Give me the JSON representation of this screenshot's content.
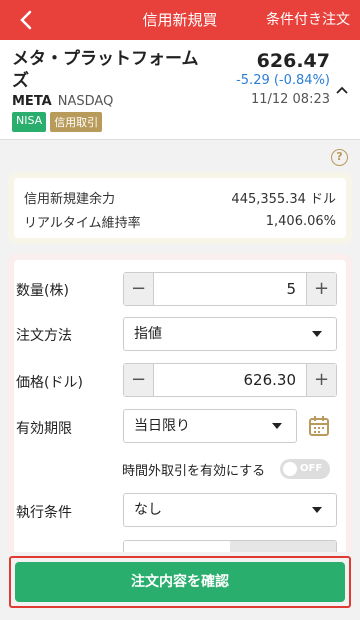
{
  "header": {
    "title": "信用新規買",
    "condition_link": "条件付き注文",
    "back_icon": "chevron-left-icon"
  },
  "stock": {
    "name": "メタ・プラットフォームズ",
    "symbol": "META",
    "exchange": "NASDAQ",
    "badges": [
      "NISA",
      "信用取引"
    ],
    "price": "626.47",
    "change": "-5.29 (-0.84%)",
    "timestamp": "11/12 08:23"
  },
  "info": {
    "rows": [
      {
        "label": "信用新規建余力",
        "value": "445,355.34 ドル"
      },
      {
        "label": "リアルタイム維持率",
        "value": "1,406.06%"
      }
    ]
  },
  "form": {
    "quantity_label": "数量(株)",
    "quantity_value": "5",
    "order_type_label": "注文方法",
    "order_type_value": "指値",
    "price_label": "価格(ドル)",
    "price_value": "626.30",
    "expiry_label": "有効期限",
    "expiry_value": "当日限り",
    "after_hours_label": "時間外取引を有効にする",
    "after_hours_toggle": "OFF",
    "execution_label": "執行条件",
    "execution_value": "なし"
  },
  "actions": {
    "confirm_label": "注文内容を確認"
  },
  "colors": {
    "header_bg": "#e8403a",
    "confirm_bg": "#2aae6d",
    "change_color": "#2b7ed6"
  }
}
